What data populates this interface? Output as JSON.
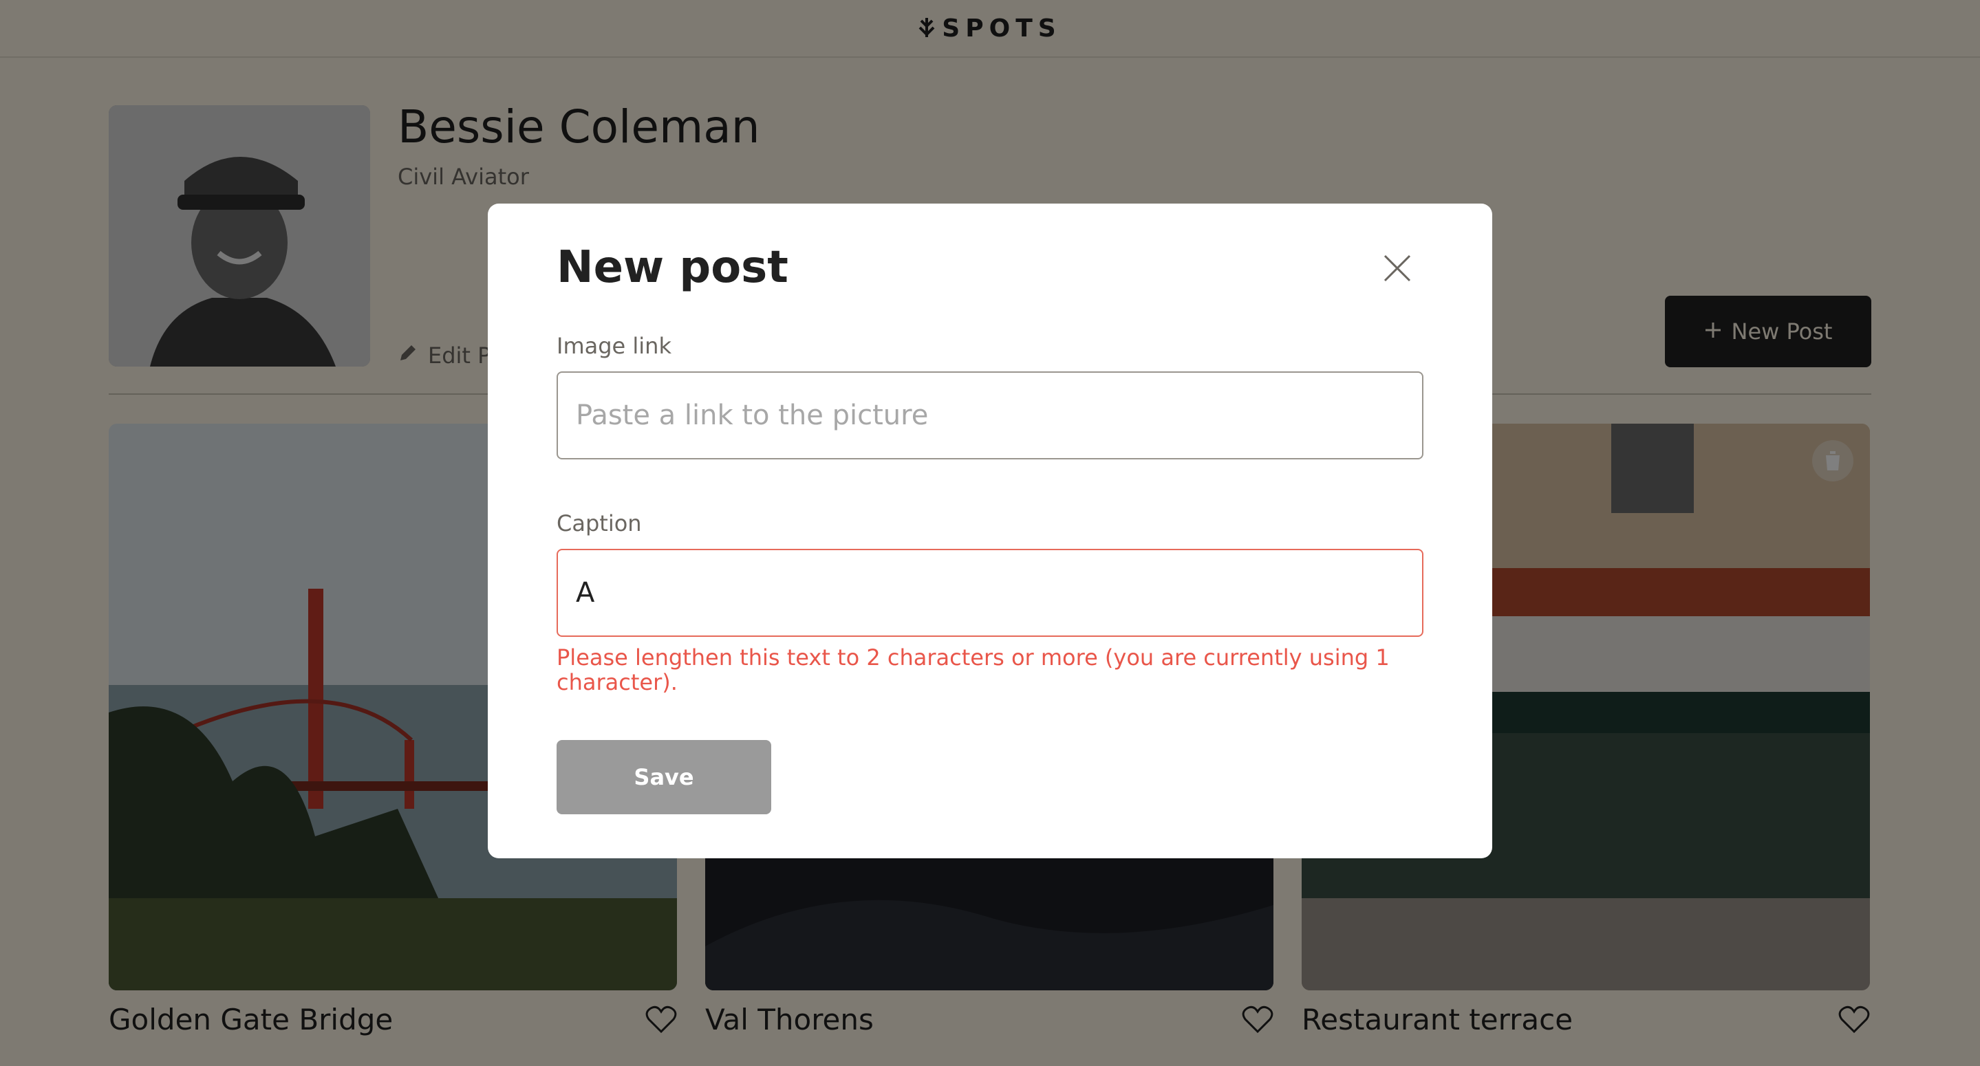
{
  "header": {
    "logo_text": "SPOTS",
    "logo_icon": "spots-logo-icon"
  },
  "profile": {
    "name": "Bessie Coleman",
    "description": "Civil Aviator",
    "edit_label": "Edit Profile",
    "new_post_label": "New Post"
  },
  "cards": [
    {
      "title": "Golden Gate Bridge"
    },
    {
      "title": "Val Thorens"
    },
    {
      "title": "Restaurant terrace"
    }
  ],
  "modal": {
    "title": "New post",
    "image_link": {
      "label": "Image link",
      "placeholder": "Paste a link to the picture",
      "value": ""
    },
    "caption": {
      "label": "Caption",
      "value": "A"
    },
    "caption_error": "Please lengthen this text to 2 characters or more (you are currently using 1 character).",
    "save_label": "Save"
  },
  "colors": {
    "background": "#fcf5e5",
    "text": "#212121",
    "error": "#e9564a",
    "button_disabled": "#9a9a9a"
  }
}
